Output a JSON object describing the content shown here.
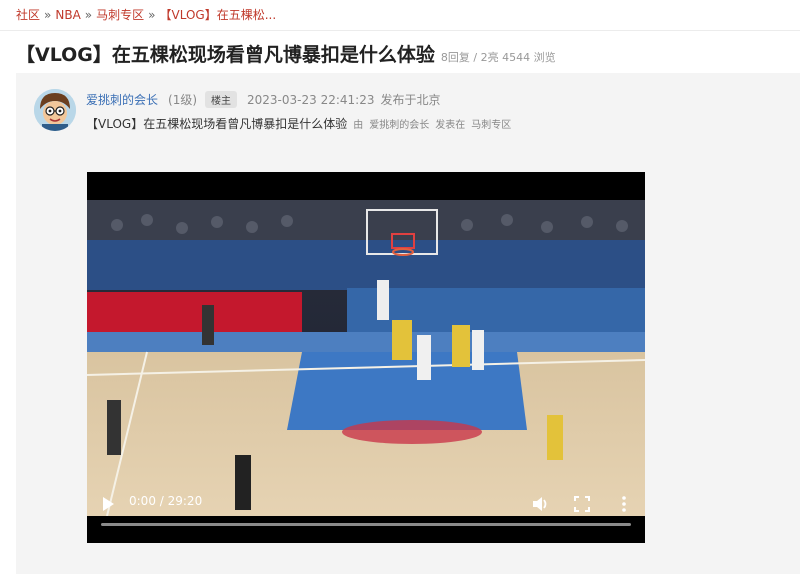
{
  "breadcrumb": {
    "items": [
      "社区",
      "NBA",
      "马刺专区",
      "【VLOG】在五棵松..."
    ],
    "separator": "»"
  },
  "thread": {
    "title": "【VLOG】在五棵松现场看曾凡博暴扣是什么体验",
    "stats": "8回复 / 2亮 4544 浏览"
  },
  "post": {
    "author": "爱挑刺的会长",
    "level": "(1级)",
    "badge": "楼主",
    "timestamp": "2023-03-23 22:41:23",
    "location": "发布于北京",
    "body_title": "【VLOG】在五棵松现场看曾凡博暴扣是什么体验",
    "by_prefix": "由",
    "by_author": "爱挑刺的会长",
    "posted_in": "发表在",
    "forum": "马刺专区"
  },
  "video": {
    "time": "0:00 / 29:20",
    "progress": 0,
    "icons": [
      "play-icon",
      "volume-icon",
      "fullscreen-icon",
      "more-options-icon"
    ]
  },
  "colors": {
    "accent_red": "#c0392b",
    "author_blue": "#3a6fb5",
    "muted": "#888888"
  }
}
